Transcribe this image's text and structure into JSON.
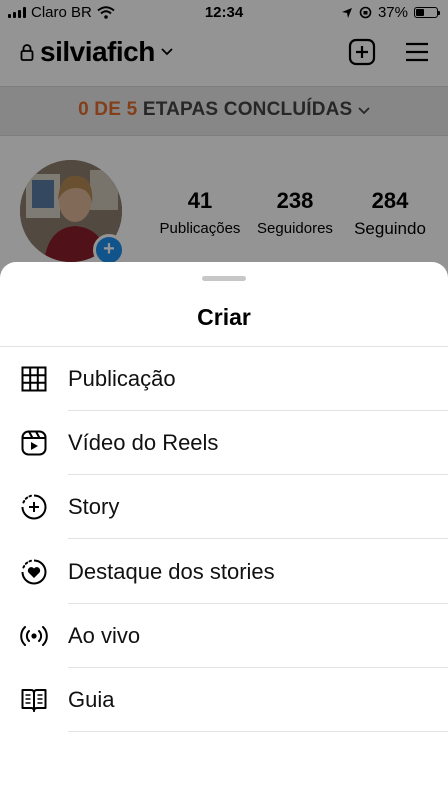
{
  "status_bar": {
    "carrier": "Claro BR",
    "time": "12:34",
    "battery": "37%"
  },
  "profile": {
    "username": "silviafich",
    "steps_count": "0 DE 5",
    "steps_text": "ETAPAS CONCLUÍDAS",
    "stats": [
      {
        "value": "41",
        "label": "Publicações"
      },
      {
        "value": "238",
        "label": "Seguidores"
      },
      {
        "value": "284",
        "label": "Seguindo"
      }
    ]
  },
  "sheet": {
    "title": "Criar",
    "items": [
      {
        "label": "Publicação",
        "icon": "grid-icon"
      },
      {
        "label": "Vídeo do Reels",
        "icon": "reels-icon"
      },
      {
        "label": "Story",
        "icon": "story-add-icon"
      },
      {
        "label": "Destaque dos stories",
        "icon": "highlight-heart-icon"
      },
      {
        "label": "Ao vivo",
        "icon": "live-icon"
      },
      {
        "label": "Guia",
        "icon": "guide-icon"
      }
    ]
  },
  "colors": {
    "accent_orange": "#e06d2b",
    "accent_blue": "#1e8ff0",
    "overlay": "rgba(0,0,0,0.42)"
  }
}
